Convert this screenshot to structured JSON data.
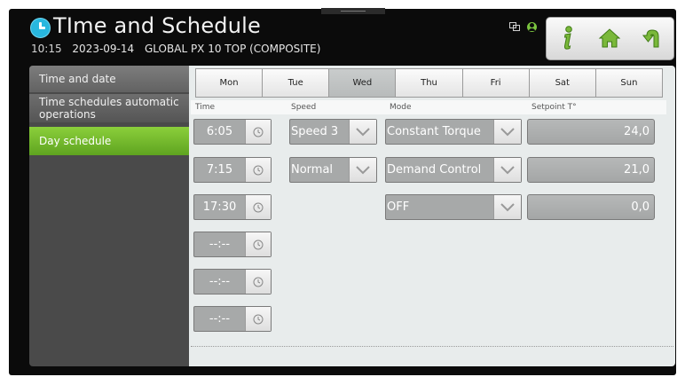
{
  "header": {
    "title": "TIme and Schedule",
    "time": "10:15",
    "date": "2023-09-14",
    "device": "GLOBAL PX 10 TOP (COMPOSITE)"
  },
  "toolbar": {
    "icons": [
      "network-icon",
      "user-icon",
      "info-icon",
      "home-icon",
      "back-icon"
    ]
  },
  "menu": {
    "items": [
      {
        "label": "Time and date"
      },
      {
        "label": "Time schedules automatic operations"
      },
      {
        "label": "Day schedule",
        "active": true
      }
    ]
  },
  "tabs": [
    {
      "label": "Mon"
    },
    {
      "label": "Tue"
    },
    {
      "label": "Wed",
      "active": true
    },
    {
      "label": "Thu"
    },
    {
      "label": "Fri"
    },
    {
      "label": "Sat"
    },
    {
      "label": "Sun"
    }
  ],
  "columns": {
    "time": "Time",
    "speed": "Speed",
    "mode": "Mode",
    "setpoint": "Setpoint T°"
  },
  "rows": [
    {
      "time": "6:05",
      "speed": "Speed 3",
      "mode": "Constant Torque",
      "setpoint": "24,0"
    },
    {
      "time": "7:15",
      "speed": "Normal",
      "mode": "Demand Control",
      "setpoint": "21,0"
    },
    {
      "time": "17:30",
      "mode": "OFF",
      "setpoint": "0,0"
    },
    {
      "time": "--:--"
    },
    {
      "time": "--:--"
    },
    {
      "time": "--:--"
    }
  ],
  "colors": {
    "accent_green": "#6db52b",
    "clock_blue": "#28b7df",
    "field_grey": "#a7a9a9"
  }
}
